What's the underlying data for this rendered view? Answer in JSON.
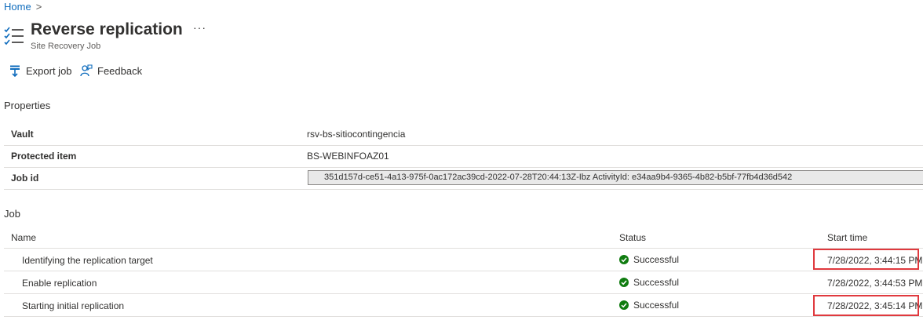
{
  "breadcrumb": {
    "home": "Home",
    "separator": ">"
  },
  "header": {
    "title": "Reverse replication",
    "subtitle": "Site Recovery Job",
    "more": "···"
  },
  "toolbar": {
    "export_label": "Export job",
    "feedback_label": "Feedback"
  },
  "properties": {
    "heading": "Properties",
    "vault_label": "Vault",
    "vault_value": "rsv-bs-sitiocontingencia",
    "item_label": "Protected item",
    "item_value": "BS-WEBINFOAZ01",
    "jobid_label": "Job id",
    "jobid_value": "351d157d-ce51-4a13-975f-0ac172ac39cd-2022-07-28T20:44:13Z-Ibz ActivityId: e34aa9b4-9365-4b82-b5bf-77fb4d36d542"
  },
  "job": {
    "heading": "Job",
    "columns": {
      "name": "Name",
      "status": "Status",
      "start": "Start time"
    },
    "rows": [
      {
        "name": "Identifying the replication target",
        "status": "Successful",
        "start": "7/28/2022, 3:44:15 PM"
      },
      {
        "name": "Enable replication",
        "status": "Successful",
        "start": "7/28/2022, 3:44:53 PM"
      },
      {
        "name": "Starting initial replication",
        "status": "Successful",
        "start": "7/28/2022, 3:45:14 PM"
      }
    ]
  },
  "colors": {
    "accent": "#0f6cbd",
    "success": "#107c10",
    "highlight": "#e0393e"
  }
}
